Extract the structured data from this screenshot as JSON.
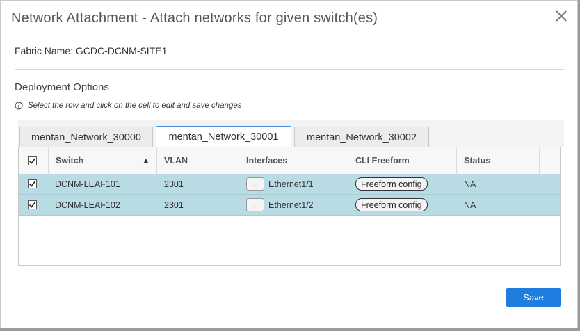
{
  "dialog": {
    "title": "Network Attachment - Attach networks for given switch(es)",
    "fabric_label": "Fabric Name: GCDC-DCNM-SITE1",
    "section_title": "Deployment Options",
    "hint": "Select the row and click on the cell to edit and save changes",
    "save_label": "Save"
  },
  "tabs": [
    {
      "label": "mentan_Network_30000",
      "active": false
    },
    {
      "label": "mentan_Network_30001",
      "active": true
    },
    {
      "label": "mentan_Network_30002",
      "active": false
    }
  ],
  "grid": {
    "columns": [
      "Switch",
      "VLAN",
      "Interfaces",
      "CLI Freeform",
      "Status"
    ],
    "sort_indicator": "▲",
    "header_checked": true,
    "rows": [
      {
        "checked": true,
        "switch": "DCNM-LEAF101",
        "vlan": "2301",
        "dots": "...",
        "interface": "Ethernet1/1",
        "freeform": "Freeform config",
        "status": "NA"
      },
      {
        "checked": true,
        "switch": "DCNM-LEAF102",
        "vlan": "2301",
        "dots": "...",
        "interface": "Ethernet1/2",
        "freeform": "Freeform config",
        "status": "NA"
      }
    ]
  },
  "colors": {
    "accent": "#1f7de0",
    "row_selected": "#b9dbe3",
    "tab_active_border": "#4a90d9"
  }
}
